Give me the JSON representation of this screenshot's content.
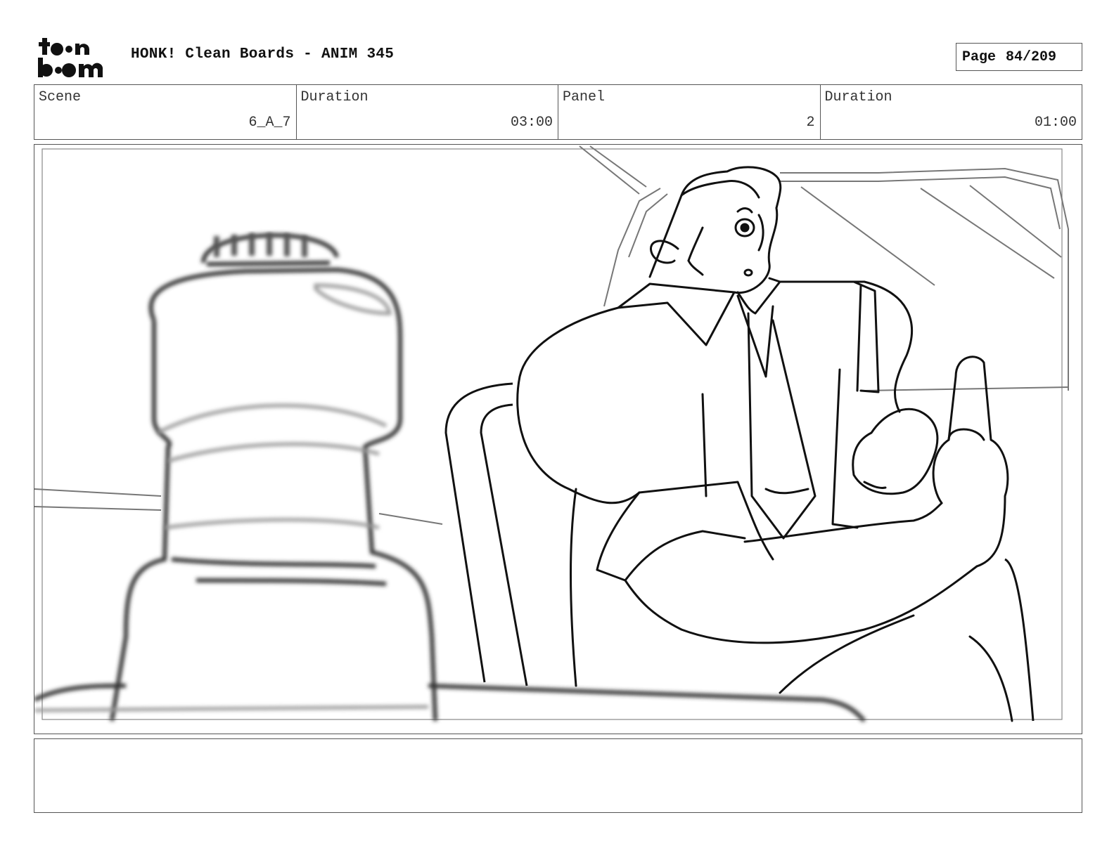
{
  "header": {
    "logo_line1": "toon",
    "logo_line2": "boom",
    "title": "HONK! Clean Boards - ANIM 345",
    "page_label": "Page",
    "page_value": "84/209"
  },
  "info": [
    {
      "label": "Scene",
      "value": "6_A_7"
    },
    {
      "label": "Duration",
      "value": "03:00"
    },
    {
      "label": "Panel",
      "value": "2"
    },
    {
      "label": "Duration",
      "value": "01:00"
    }
  ],
  "panel": {
    "image_subject": "storyboard-sketch"
  },
  "notes": {
    "text": ""
  }
}
